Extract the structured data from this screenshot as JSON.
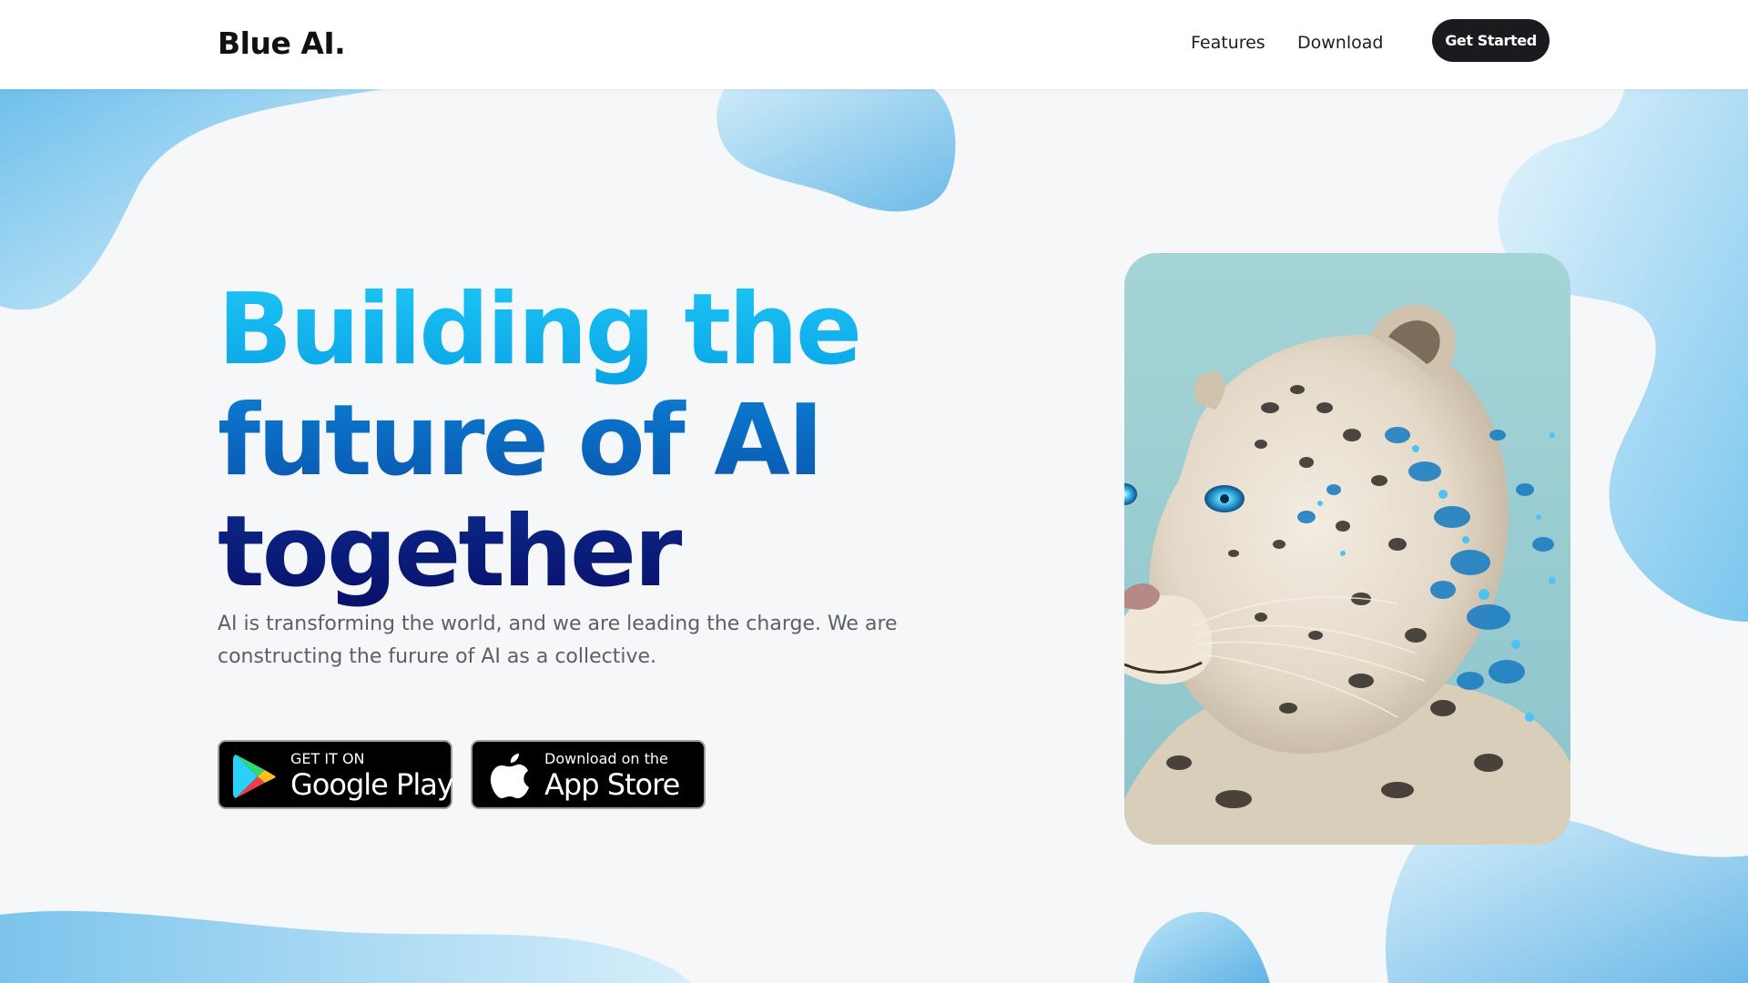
{
  "header": {
    "logo": "Blue AI.",
    "nav": [
      {
        "label": "Features"
      },
      {
        "label": "Download"
      }
    ],
    "cta_label": "Get Started"
  },
  "hero": {
    "title_lines": [
      "Building the",
      "future of AI",
      "together"
    ],
    "subtitle": "AI is transforming the world, and we are leading the charge. We are constructing the furure of AI as a collective.",
    "title_colors": [
      "#15b8f0",
      "#0b6ec8",
      "#0a1a7a"
    ]
  },
  "badges": {
    "google": {
      "small": "GET IT ON",
      "large": "Google Play",
      "icon": "google-play-icon"
    },
    "apple": {
      "small": "Download on the",
      "large": "App Store",
      "icon": "apple-icon"
    }
  },
  "image": {
    "subject": "snow-leopard-illustration"
  },
  "colors": {
    "accent": "#1b1b1f",
    "blob": "#7cc4ec",
    "background": "#f6f7f8"
  }
}
